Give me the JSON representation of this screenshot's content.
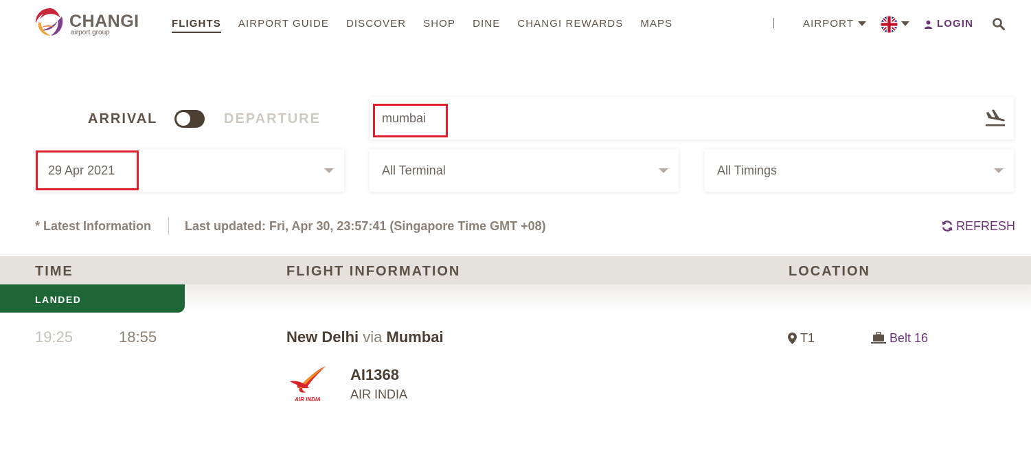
{
  "brand": {
    "name": "CHANGI",
    "subtitle": "airport group"
  },
  "nav": {
    "items": [
      {
        "label": "FLIGHTS",
        "active": true
      },
      {
        "label": "AIRPORT GUIDE",
        "active": false
      },
      {
        "label": "DISCOVER",
        "active": false
      },
      {
        "label": "SHOP",
        "active": false
      },
      {
        "label": "DINE",
        "active": false
      },
      {
        "label": "CHANGI REWARDS",
        "active": false
      },
      {
        "label": "MAPS",
        "active": false
      }
    ],
    "airport_label": "AIRPORT",
    "login_label": "LOGIN"
  },
  "filters": {
    "arrival_label": "ARRIVAL",
    "departure_label": "DEPARTURE",
    "search_value": "mumbai",
    "date": "29 Apr 2021",
    "terminal": "All Terminal",
    "timings": "All Timings"
  },
  "info": {
    "latest": "* Latest Information",
    "last_updated": "Last updated: Fri, Apr 30, 23:57:41 (Singapore Time GMT +08)",
    "refresh_label": "REFRESH"
  },
  "table": {
    "headers": {
      "time": "TIME",
      "flight": "FLIGHT INFORMATION",
      "location": "LOCATION"
    }
  },
  "flight": {
    "status": "LANDED",
    "scheduled_time": "19:25",
    "actual_time": "18:55",
    "origin": "New Delhi",
    "via_word": "via",
    "via_city": "Mumbai",
    "flight_number": "AI1368",
    "airline": "AIR INDIA",
    "airline_logo_text": "AIR INDIA",
    "terminal": "T1",
    "belt": "Belt 16"
  },
  "colors": {
    "brand_brown": "#5e5247",
    "accent_purple": "#6c3577",
    "landed_green": "#1f6637",
    "highlight_red": "#e0212b"
  }
}
